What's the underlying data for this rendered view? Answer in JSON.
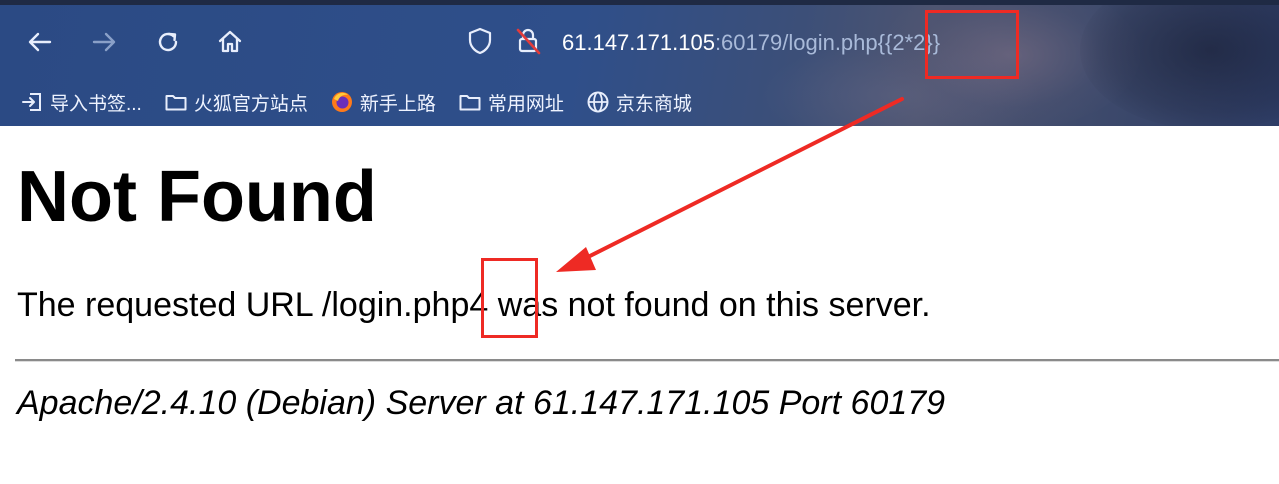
{
  "browser": {
    "url": {
      "host": "61.147.171.105",
      "rest": ":60179/login.php",
      "payload": "{{2*2}}"
    },
    "buttons": {
      "back": "back-arrow-icon",
      "forward": "forward-arrow-icon",
      "reload": "reload-icon",
      "home": "home-icon"
    },
    "bookmarks": [
      {
        "label": "导入书签...",
        "icon": "import-icon"
      },
      {
        "label": "火狐官方站点",
        "icon": "folder-icon"
      },
      {
        "label": "新手上路",
        "icon": "firefox-icon"
      },
      {
        "label": "常用网址",
        "icon": "folder-icon"
      },
      {
        "label": "京东商城",
        "icon": "globe-icon"
      }
    ]
  },
  "page": {
    "heading": "Not Found",
    "message_before": "The requested URL /login.php",
    "message_highlight": "4",
    "message_after": " was not found on this server.",
    "server_line": "Apache/2.4.10 (Debian) Server at 61.147.171.105 Port 60179"
  },
  "annotation": {
    "color": "#ee2a24"
  }
}
